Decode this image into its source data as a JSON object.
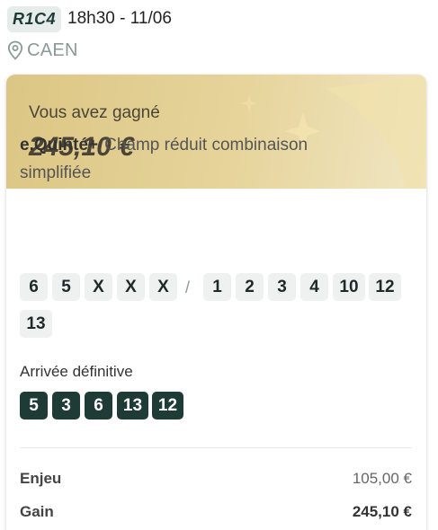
{
  "race": {
    "code": "R1C4",
    "time_date": "18h30 - 11/06",
    "location": "CAEN",
    "location_icon": "location-pin-icon"
  },
  "result_card": {
    "win_label": "Vous avez gagné",
    "win_amount": "245,10 €",
    "banner_color": "#dcc684",
    "bet_type": "e.Quinté+",
    "bet_description_line1": "Champ réduit combinaison",
    "bet_description_line2": "simplifiée",
    "selection_base": [
      "6",
      "5",
      "X",
      "X",
      "X"
    ],
    "selection_separator": "/",
    "selection_field": [
      "1",
      "2",
      "3",
      "4",
      "10",
      "12",
      "13"
    ],
    "arrival_label": "Arrivée définitive",
    "arrival": [
      "5",
      "3",
      "6",
      "13",
      "12"
    ],
    "arrival_color": "#1e3b35",
    "stake_label": "Enjeu",
    "stake_value": "105,00 €",
    "gain_label": "Gain",
    "gain_value": "245,10 €"
  }
}
